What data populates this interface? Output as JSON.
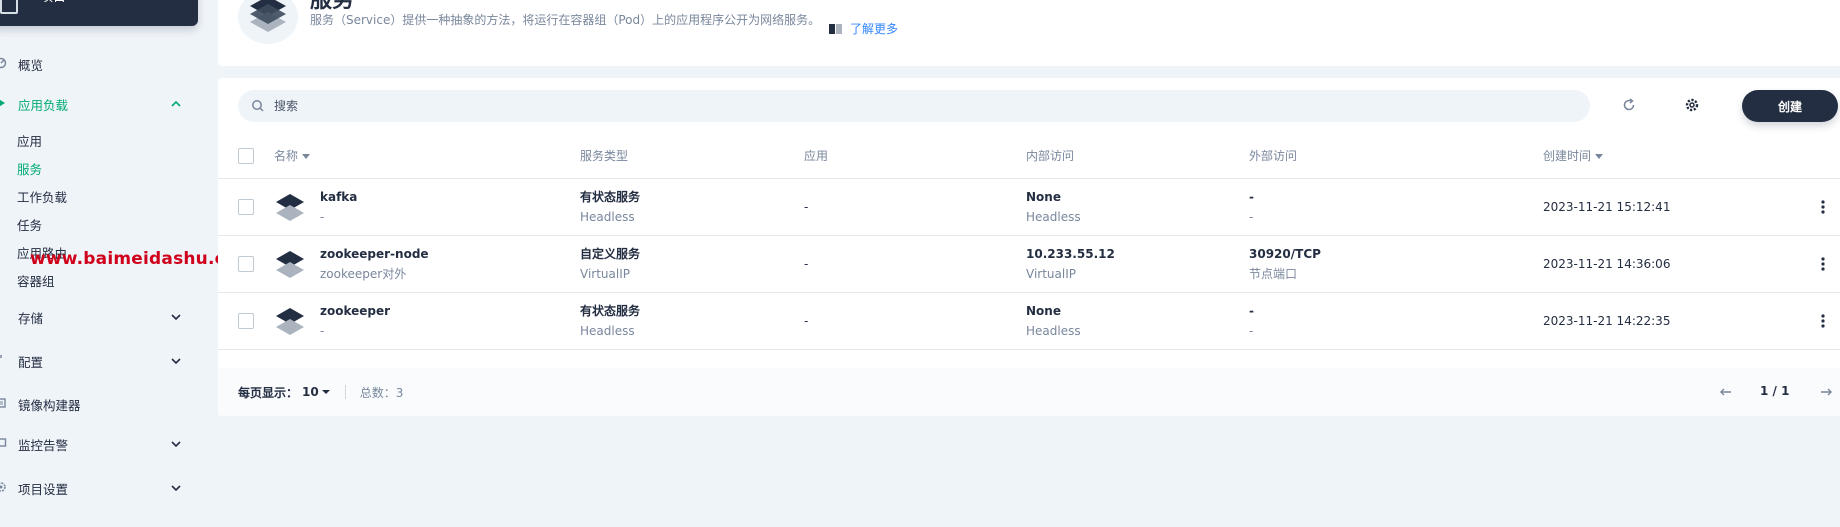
{
  "sidebar": {
    "project_label": "项目",
    "groups": [
      {
        "label": "概览",
        "icon": "dashboard-icon"
      },
      {
        "label": "应用负载",
        "icon": "appstore-icon",
        "active": true
      },
      {
        "label": "存储",
        "icon": "storage-icon"
      },
      {
        "label": "配置",
        "icon": "config-icon"
      },
      {
        "label": "镜像构建器",
        "icon": "image-builder-icon"
      },
      {
        "label": "监控告警",
        "icon": "monitor-icon"
      },
      {
        "label": "项目设置",
        "icon": "settings-icon"
      }
    ],
    "subitems": [
      {
        "label": "应用"
      },
      {
        "label": "服务",
        "active": true
      },
      {
        "label": "工作负载"
      },
      {
        "label": "任务"
      },
      {
        "label": "应用路由"
      },
      {
        "label": "容器组"
      }
    ],
    "watermark": "www.baimeidashu.com-白眉大叔"
  },
  "header": {
    "title": "服务",
    "description": "服务（Service）提供一种抽象的方法，将运行在容器组（Pod）上的应用程序公开为网络服务。",
    "learn_more": "了解更多"
  },
  "toolbar": {
    "search_placeholder": "搜索",
    "create_label": "创建"
  },
  "table": {
    "columns": {
      "name": "名称",
      "type": "服务类型",
      "app": "应用",
      "internal": "内部访问",
      "external": "外部访问",
      "created": "创建时间"
    },
    "rows": [
      {
        "name": "kafka",
        "name_sub": "-",
        "type": "有状态服务",
        "type_sub": "Headless",
        "app": "-",
        "internal": "None",
        "internal_sub": "Headless",
        "external": "-",
        "external_sub": "-",
        "created": "2023-11-21 15:12:41"
      },
      {
        "name": "zookeeper-node",
        "name_sub": "zookeeper对外",
        "type": "自定义服务",
        "type_sub": "VirtualIP",
        "app": "-",
        "internal": "10.233.55.12",
        "internal_sub": "VirtualIP",
        "external": "30920/TCP",
        "external_sub": "节点端口",
        "created": "2023-11-21 14:36:06"
      },
      {
        "name": "zookeeper",
        "name_sub": "-",
        "type": "有状态服务",
        "type_sub": "Headless",
        "app": "-",
        "internal": "None",
        "internal_sub": "Headless",
        "external": "-",
        "external_sub": "-",
        "created": "2023-11-21 14:22:35"
      }
    ]
  },
  "pagination": {
    "per_page_label": "每页显示：",
    "per_page_value": "10",
    "total_label": "总数：3",
    "page": "1 / 1"
  },
  "colors": {
    "accent": "#00aa72",
    "dark": "#242e42",
    "link": "#3385ff",
    "watermark": "#d0021b"
  }
}
